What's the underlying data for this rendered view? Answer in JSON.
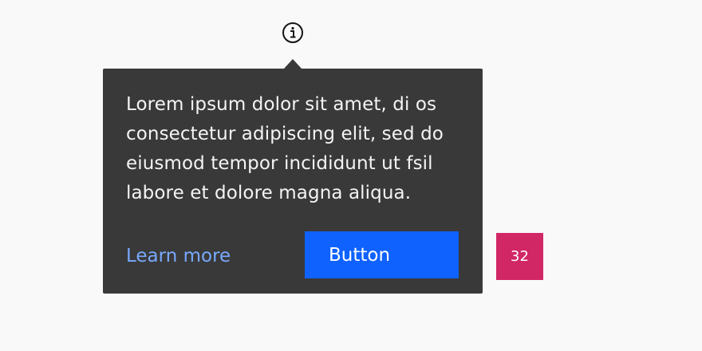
{
  "trigger": {
    "icon": "information-icon"
  },
  "tooltip": {
    "body": "Lorem ipsum dolor sit amet, di os consectetur adipiscing elit, sed do eiusmod tempor incididunt ut fsil labore et dolore magna aliqua.",
    "link_label": "Learn more",
    "button_label": "Button"
  },
  "spec_badge": {
    "value": "32"
  },
  "colors": {
    "background": "#f9f9f9",
    "tooltip_background": "#393939",
    "tooltip_text": "#f4f4f4",
    "link": "#78a9ff",
    "button": "#0f62fe",
    "badge": "#d12765"
  }
}
